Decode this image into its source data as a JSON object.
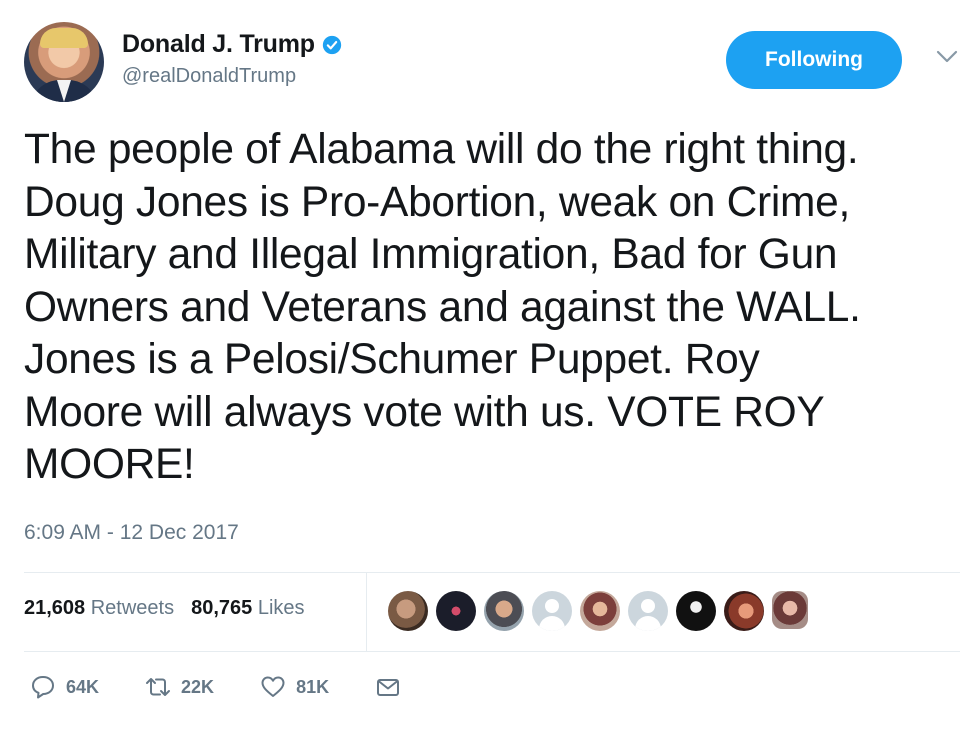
{
  "author": {
    "name": "Donald J. Trump",
    "handle": "@realDonaldTrump",
    "verified": true
  },
  "follow_button": {
    "label": "Following"
  },
  "tweet": {
    "lines": [
      "The people of Alabama will do the right thing.",
      "Doug Jones is Pro-Abortion, weak on Crime,",
      "Military and Illegal Immigration, Bad for Gun",
      "Owners and Veterans and against the WALL.",
      "Jones is a Pelosi/Schumer Puppet. Roy",
      "Moore will always vote with us. VOTE ROY",
      "MOORE!"
    ],
    "timestamp": "6:09 AM - 12 Dec 2017"
  },
  "stats": {
    "retweets_count": "21,608",
    "retweets_label": "Retweets",
    "likes_count": "80,765",
    "likes_label": "Likes"
  },
  "actions": {
    "reply_count": "64K",
    "retweet_count": "22K",
    "like_count": "81K"
  },
  "icons": {
    "verified": "verified-badge-icon",
    "menu": "chevron-down-icon",
    "reply": "reply-icon",
    "retweet": "retweet-icon",
    "like": "heart-icon",
    "dm": "envelope-icon"
  },
  "colors": {
    "accent": "#1da1f2",
    "secondary_text": "#657786",
    "primary_text": "#14171a"
  }
}
